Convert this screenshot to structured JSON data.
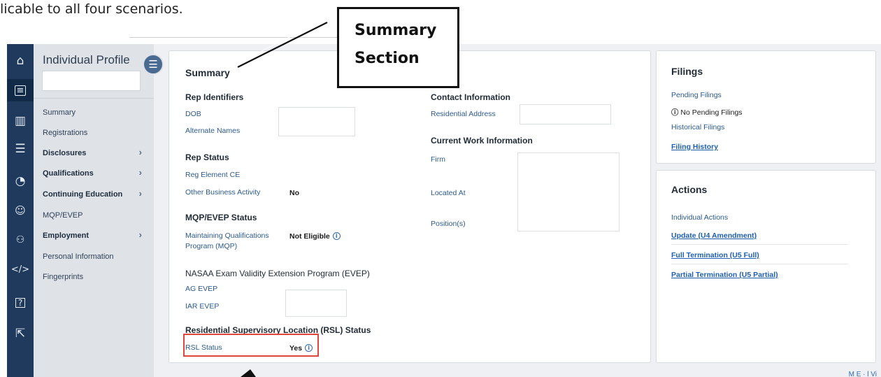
{
  "page_header_text": "licable  to all four  scenarios.",
  "callout": {
    "line1": "Summary",
    "line2": "Section"
  },
  "rail_icons": [
    "home-icon",
    "id-card-icon",
    "library-icon",
    "checklist-icon",
    "chart-pie-icon",
    "user-gear-icon",
    "users-icon",
    "code-icon",
    "help-icon",
    "external-link-icon"
  ],
  "sidenav": {
    "title": "Individual Profile",
    "items": [
      {
        "label": "Summary",
        "bold": false,
        "chevron": false
      },
      {
        "label": "Registrations",
        "bold": false,
        "chevron": false
      },
      {
        "label": "Disclosures",
        "bold": true,
        "chevron": true
      },
      {
        "label": "Qualifications",
        "bold": true,
        "chevron": true
      },
      {
        "label": "Continuing Education",
        "bold": true,
        "chevron": true
      },
      {
        "label": "MQP/EVEP",
        "bold": false,
        "chevron": false
      },
      {
        "label": "Employment",
        "bold": true,
        "chevron": true
      },
      {
        "label": "Personal Information",
        "bold": false,
        "chevron": false
      },
      {
        "label": "Fingerprints",
        "bold": false,
        "chevron": false
      }
    ]
  },
  "summary": {
    "title": "Summary",
    "rep_identifiers": {
      "heading": "Rep Identifiers",
      "dob_label": "DOB",
      "alt_names_label": "Alternate Names"
    },
    "rep_status": {
      "heading": "Rep Status",
      "reg_element_label": "Reg Element CE",
      "oba_label": "Other Business Activity",
      "oba_value": "No"
    },
    "mqp_status": {
      "heading": "MQP/EVEP Status",
      "mqp_label": "Maintaining Qualifications Program (MQP)",
      "mqp_value": "Not Eligible"
    },
    "nasaa": {
      "heading": "NASAA Exam Validity Extension Program (EVEP)",
      "ag_label": "AG EVEP",
      "iar_label": "IAR EVEP"
    },
    "rsl": {
      "heading": "Residential Supervisory Location (RSL) Status",
      "label": "RSL Status",
      "value": "Yes"
    },
    "contact": {
      "heading": "Contact Information",
      "address_label": "Residential Address"
    },
    "work": {
      "heading": "Current Work Information",
      "firm_label": "Firm",
      "located_label": "Located At",
      "position_label": "Position(s)"
    }
  },
  "filings": {
    "title": "Filings",
    "pending_label": "Pending Filings",
    "pending_status": "No Pending Filings",
    "historical_label": "Historical Filings",
    "history_link": "Filing History"
  },
  "actions": {
    "title": "Actions",
    "subtitle": "Individual Actions",
    "links": [
      "Update (U4 Amendment)",
      "Full Termination (U5 Full)",
      "Partial Termination (U5 Partial)"
    ]
  },
  "info_glyph": "i",
  "footer_text": "M  E  · l Vi"
}
